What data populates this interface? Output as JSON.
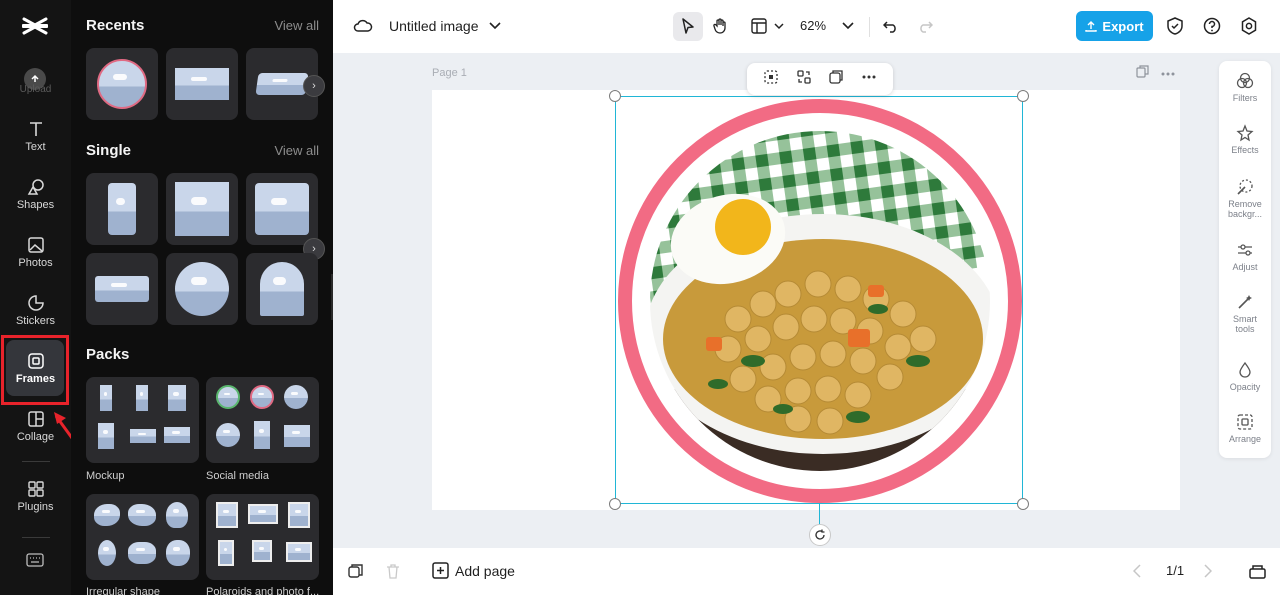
{
  "app": {
    "doc_title": "Untitled image",
    "zoom": "62%",
    "export_label": "Export"
  },
  "rail": {
    "upload_label": "Upload",
    "items": [
      {
        "label": "Text",
        "icon": "text-icon"
      },
      {
        "label": "Shapes",
        "icon": "shapes-icon"
      },
      {
        "label": "Photos",
        "icon": "photos-icon"
      },
      {
        "label": "Stickers",
        "icon": "stickers-icon"
      },
      {
        "label": "Frames",
        "icon": "frames-icon"
      },
      {
        "label": "Collage",
        "icon": "collage-icon"
      },
      {
        "label": "Plugins",
        "icon": "plugins-icon"
      }
    ],
    "active": "Frames"
  },
  "panel": {
    "recents_title": "Recents",
    "single_title": "Single",
    "packs_title": "Packs",
    "view_all": "View all",
    "packs": [
      {
        "label": "Mockup"
      },
      {
        "label": "Social media"
      },
      {
        "label": "Irregular shape"
      },
      {
        "label": "Polaroids and photo f..."
      }
    ]
  },
  "canvas": {
    "page_label": "Page 1",
    "frame_color": "#f26b84",
    "selection_color": "#20b6d6"
  },
  "right_panel": {
    "items": [
      {
        "label": "Filters",
        "icon": "filters-icon"
      },
      {
        "label": "Effects",
        "icon": "effects-icon"
      },
      {
        "label": "Remove backgr...",
        "icon": "remove-background-icon"
      },
      {
        "label": "Adjust",
        "icon": "adjust-icon"
      },
      {
        "label": "Smart tools",
        "icon": "smart-tools-icon"
      },
      {
        "label": "Opacity",
        "icon": "opacity-icon"
      },
      {
        "label": "Arrange",
        "icon": "arrange-icon"
      }
    ]
  },
  "bottom": {
    "add_page_label": "Add page",
    "pager": "1/1"
  },
  "colors": {
    "accent": "#16a2e8",
    "highlight": "#e8232b"
  }
}
